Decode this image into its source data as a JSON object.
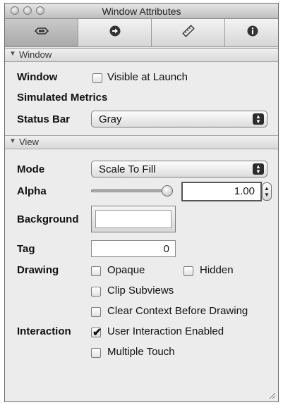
{
  "window": {
    "title": "Window Attributes"
  },
  "tabs": [
    {
      "name": "attributes",
      "icon": "attributes-icon"
    },
    {
      "name": "connections",
      "icon": "arrow-right-circle-icon"
    },
    {
      "name": "size",
      "icon": "ruler-icon"
    },
    {
      "name": "identity",
      "icon": "info-icon"
    }
  ],
  "sections": {
    "window": {
      "title": "Window",
      "window_label": "Window",
      "visible_at_launch": {
        "label": "Visible at Launch",
        "checked": false
      },
      "simulated_metrics": "Simulated Metrics",
      "status_bar_label": "Status Bar",
      "status_bar_value": "Gray"
    },
    "view": {
      "title": "View",
      "mode_label": "Mode",
      "mode_value": "Scale To Fill",
      "alpha_label": "Alpha",
      "alpha_value": "1.00",
      "alpha_level": 1.0,
      "background_label": "Background",
      "background_color": "#ffffff",
      "tag_label": "Tag",
      "tag_value": "0",
      "drawing_label": "Drawing",
      "opaque": {
        "label": "Opaque",
        "checked": false
      },
      "hidden": {
        "label": "Hidden",
        "checked": false
      },
      "clip_subviews": {
        "label": "Clip Subviews",
        "checked": false
      },
      "clear_context": {
        "label": "Clear Context Before Drawing",
        "checked": false
      },
      "interaction_label": "Interaction",
      "user_interaction": {
        "label": "User Interaction Enabled",
        "checked": true
      },
      "multiple_touch": {
        "label": "Multiple Touch",
        "checked": false
      }
    }
  }
}
